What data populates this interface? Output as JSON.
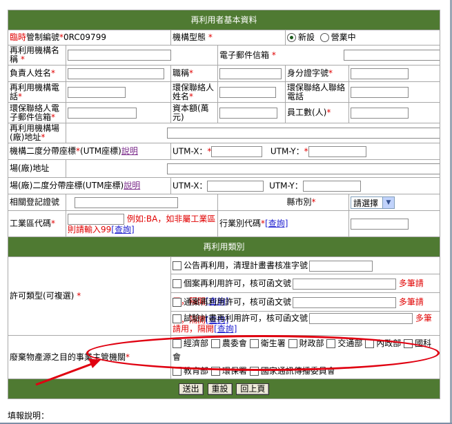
{
  "section1_title": "再利用者基本資料",
  "section2_title": "再利用類別",
  "row_control": {
    "label_red": "臨時",
    "label": "管制編號",
    "value": "0RC09799",
    "type_label": "機構型態",
    "opt_new": "新設",
    "opt_running": "營業中"
  },
  "row_name": {
    "label": "再利用機構名稱",
    "email_label": "電子郵件信箱"
  },
  "row_person": {
    "label": "負責人姓名",
    "title_label": "職稱",
    "id_label": "身分證字號"
  },
  "row_phone": {
    "label": "再利用機構電話",
    "env_contact_label": "環保聯絡人姓名",
    "env_phone_label": "環保聯絡人聯絡電話"
  },
  "row_email2": {
    "label": "環保聯絡人電子郵件信箱",
    "capital_label": "資本額(萬元)",
    "employees_label": "員工數(人)"
  },
  "row_address": {
    "label": "再利用機構場(廠)地址"
  },
  "row_utm1": {
    "label": "機構二度分帶座標",
    "suffix": "(UTM座標)",
    "link": "說明",
    "x_label": "UTM-X：",
    "y_label": "UTM-Y："
  },
  "row_site_addr": {
    "label": "場(廠)地址"
  },
  "row_utm2": {
    "label": "場(廠)二度分帶座標(UTM座標)",
    "link": "說明",
    "x_label": "UTM-X：",
    "y_label": "UTM-Y："
  },
  "row_reg": {
    "label": "相關登記證號",
    "county_label": "縣市別",
    "county_select": "請選擇"
  },
  "row_industry": {
    "label": "工業區代碼",
    "hint": "例如:BA，如非屬工業區則請輸入99",
    "query": "[查詢]",
    "industry_label": "行業別代碼",
    "query2": "[查詢]"
  },
  "permit": {
    "label": "許可類型(可複選)",
    "options": [
      {
        "text": "公告再利用，清理計畫書核准字號"
      },
      {
        "text": "個案再利用許可，核可函文號",
        "note": "多筆請用，隔開",
        "query": "[查詢]"
      },
      {
        "text": "通案再利用許可，核可函文號",
        "note": "多筆請用，隔開",
        "query": "[查詢]"
      },
      {
        "text": "試驗計畫再利用許可，核可函文號",
        "note": "多筆請用，隔開",
        "query": "[查詢]"
      }
    ]
  },
  "agency": {
    "label": "廢棄物產源之目的事業主管機關",
    "items": [
      "經濟部",
      "農委會",
      "衛生署",
      "財政部",
      "交通部",
      "內政部",
      "國科會",
      "教育部",
      "環保署",
      "國家通訊傳播委員會"
    ]
  },
  "buttons": {
    "submit": "送出",
    "reset": "重設",
    "back": "回上頁"
  },
  "footer": "填報說明：",
  "colors": {
    "header_green": "#4f7a32",
    "required_red": "#e00000",
    "link_blue": "#2020d0",
    "annotation_red": "#e00010"
  }
}
